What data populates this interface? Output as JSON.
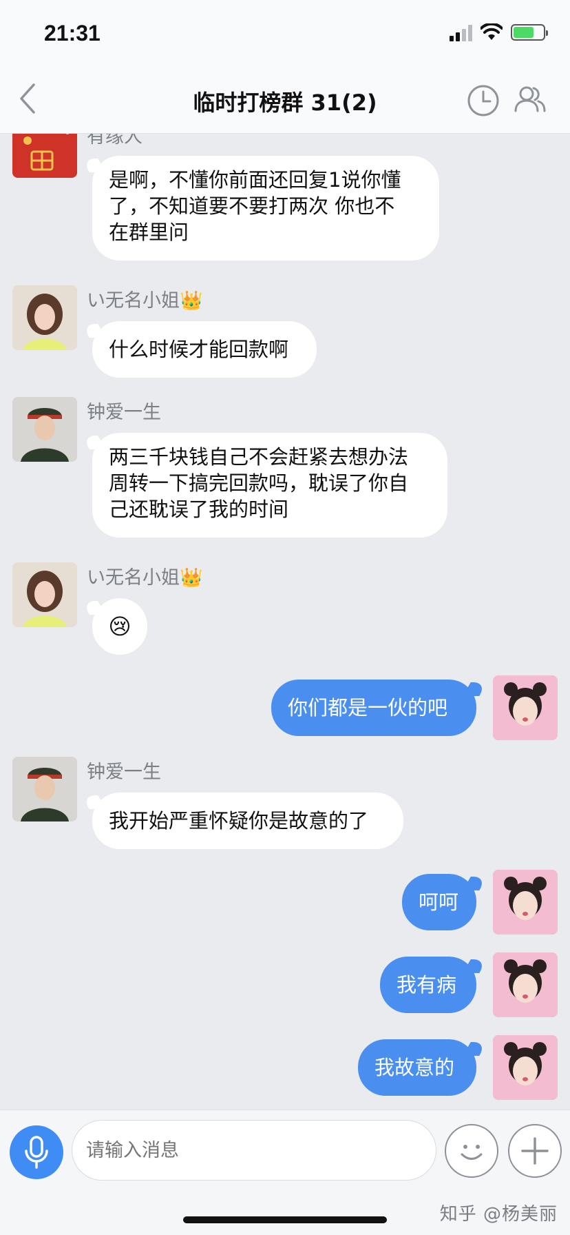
{
  "status_bar": {
    "time": "21:31"
  },
  "nav": {
    "title": "临时打榜群 31(2)"
  },
  "messages": [
    {
      "sender": "有缘人",
      "lines": [
        "是啊，不懂你前面还回复1说你懂",
        "了，不知道要不要打两次 你也不",
        "在群里问"
      ]
    },
    {
      "sender": "い无名小姐",
      "sender_badge": "👑",
      "lines": [
        "什么时候才能回款啊"
      ]
    },
    {
      "sender": "钟爱一生",
      "lines": [
        "两三千块钱自己不会赶紧去想办法",
        "周转一下搞完回款吗，耽误了你自",
        "己还耽误了我的时间"
      ]
    },
    {
      "sender": "い无名小姐",
      "sender_badge": "👑",
      "emoji": "😢"
    },
    {
      "self": true,
      "text": "你们都是一伙的吧"
    },
    {
      "sender": "钟爱一生",
      "lines": [
        "我开始严重怀疑你是故意的了"
      ]
    },
    {
      "self": true,
      "text": "呵呵"
    },
    {
      "self": true,
      "text": "我有病"
    },
    {
      "self": true,
      "text": "我故意的"
    }
  ],
  "input": {
    "placeholder": "请输入消息"
  },
  "watermark": "知乎 @杨美丽",
  "colors": {
    "accent": "#4a8ff0",
    "background": "#e9ebef"
  },
  "icons": [
    "back-icon",
    "history-clock-icon",
    "group-members-icon",
    "mic-icon",
    "emoji-icon",
    "plus-icon"
  ]
}
